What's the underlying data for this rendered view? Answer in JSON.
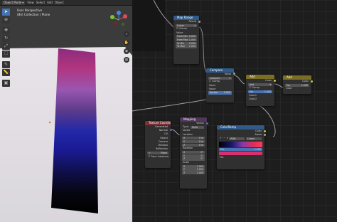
{
  "topbar": {
    "mode": "Object Mode",
    "menus": [
      "View",
      "Select",
      "Add",
      "Object"
    ]
  },
  "viewport": {
    "info_line1": "User Perspective",
    "info_line2": "(84) Collection | Plane"
  },
  "tools": [
    "select-icon",
    "cursor-icon",
    "move-icon",
    "rotate-icon",
    "scale-icon",
    "transform-icon",
    "annotate-icon",
    "measure-icon",
    "add-cube-icon"
  ],
  "nodes": {
    "map_range": {
      "title": "Map Range",
      "out": "Result",
      "mode": "Linear",
      "clamp": "Clamp",
      "value": "Value",
      "rows": [
        [
          "From Min",
          "0.000"
        ],
        [
          "From Max",
          "1.000"
        ],
        [
          "To Min",
          "0.000"
        ],
        [
          "To Max",
          "1.000"
        ]
      ]
    },
    "compare": {
      "title": "Compare",
      "out": "Value",
      "op": "Compare",
      "clamp": "Clamp",
      "in1": "Value",
      "in2": "Value",
      "eps_label": "Epsilon",
      "eps_val": "0.000"
    },
    "mix1": {
      "title": "Add",
      "out": "Color",
      "blend": "Add",
      "clamp": "Clamp",
      "fac": "Fac",
      "fac_val": "1.000",
      "c1": "Color1",
      "c2": "Color2"
    },
    "mix2": {
      "title": "Add",
      "out": "Color",
      "fac": "Fac",
      "fac_val": "1.000",
      "c": "Color"
    },
    "texcoord": {
      "title": "Texture Coordinate",
      "outs": [
        "Generated",
        "Normal",
        "UV",
        "Object",
        "Camera",
        "Window",
        "Reflection"
      ],
      "obj": "Plane",
      "from_instancer": "From Instancer"
    },
    "mapping": {
      "title": "Mapping",
      "out": "Vector",
      "type_label": "Type:",
      "type_val": "Point",
      "vector": "Vector",
      "loc_label": "Location",
      "loc": [
        [
          "X",
          "0 m"
        ],
        [
          "Y",
          "0 m"
        ],
        [
          "Z",
          "0 m"
        ]
      ],
      "rot_label": "Rotation",
      "rot": [
        [
          "X",
          "0°"
        ],
        [
          "Y",
          "0°"
        ],
        [
          "Z",
          "0°"
        ]
      ],
      "scale_label": "Scale",
      "scale": [
        [
          "X",
          "1.000"
        ],
        [
          "Y",
          "1.000"
        ],
        [
          "Z",
          "1.000"
        ]
      ]
    },
    "colorramp": {
      "title": "ColorRamp",
      "outs": [
        "Color",
        "Alpha"
      ],
      "mode": "RGB",
      "interp": "Linear",
      "pos_label": "Pos",
      "pos_val": "1.000",
      "fac": "Fac"
    }
  },
  "colors": {
    "accent": "#4772b3",
    "header_vector": "#52365c",
    "header_converter": "#2f5a8a",
    "header_input": "#7e2f35",
    "header_color": "#7a6e25"
  }
}
